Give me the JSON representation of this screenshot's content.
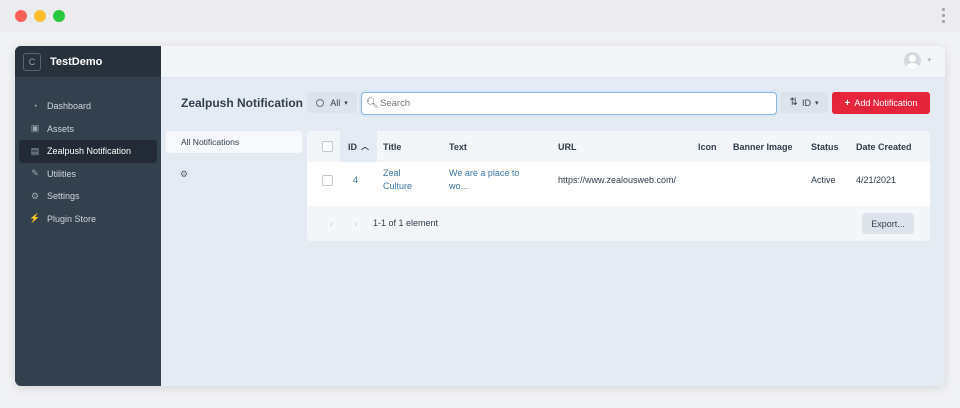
{
  "window": {
    "buttons": [
      "close",
      "minimize",
      "zoom"
    ],
    "menu_icon": "more-vertical-icon"
  },
  "sidebar": {
    "logo_letter": "C",
    "site_name": "TestDemo",
    "items": [
      {
        "label": "Dashboard",
        "icon": "dashboard-icon",
        "glyph": "◔"
      },
      {
        "label": "Assets",
        "icon": "image-icon",
        "glyph": "▣"
      },
      {
        "label": "Zealpush Notification",
        "icon": "notification-icon",
        "glyph": "▤",
        "active": true
      },
      {
        "label": "Utilities",
        "icon": "wrench-icon",
        "glyph": "✎"
      },
      {
        "label": "Settings",
        "icon": "gear-icon",
        "glyph": "⚙"
      },
      {
        "label": "Plugin Store",
        "icon": "plug-icon",
        "glyph": "⚡"
      }
    ]
  },
  "header": {
    "avatar": "user-avatar-icon"
  },
  "page": {
    "title": "Zealpush Notification",
    "filter_label": "All",
    "search_placeholder": "Search",
    "sort_label": "ID",
    "add_label": "Add Notification"
  },
  "left_pane": {
    "label": "All Notifications"
  },
  "table": {
    "columns": [
      "ID",
      "Title",
      "Text",
      "URL",
      "Icon",
      "Banner Image",
      "Status",
      "Date Created"
    ],
    "rows": [
      {
        "id": "4",
        "title_line1": "Zeal",
        "title_line2": "Culture",
        "text_line1": "We are a place to",
        "text_line2": "wo...",
        "url": "https://www.zealousweb.com/",
        "icon": "",
        "banner_image": "",
        "status": "Active",
        "date_created": "4/21/2021"
      }
    ],
    "pagination": "1-1 of 1 element",
    "export_label": "Export..."
  },
  "colors": {
    "sidebar": "#33404d",
    "accent_red": "#e5253a",
    "link": "#3d76a7"
  }
}
